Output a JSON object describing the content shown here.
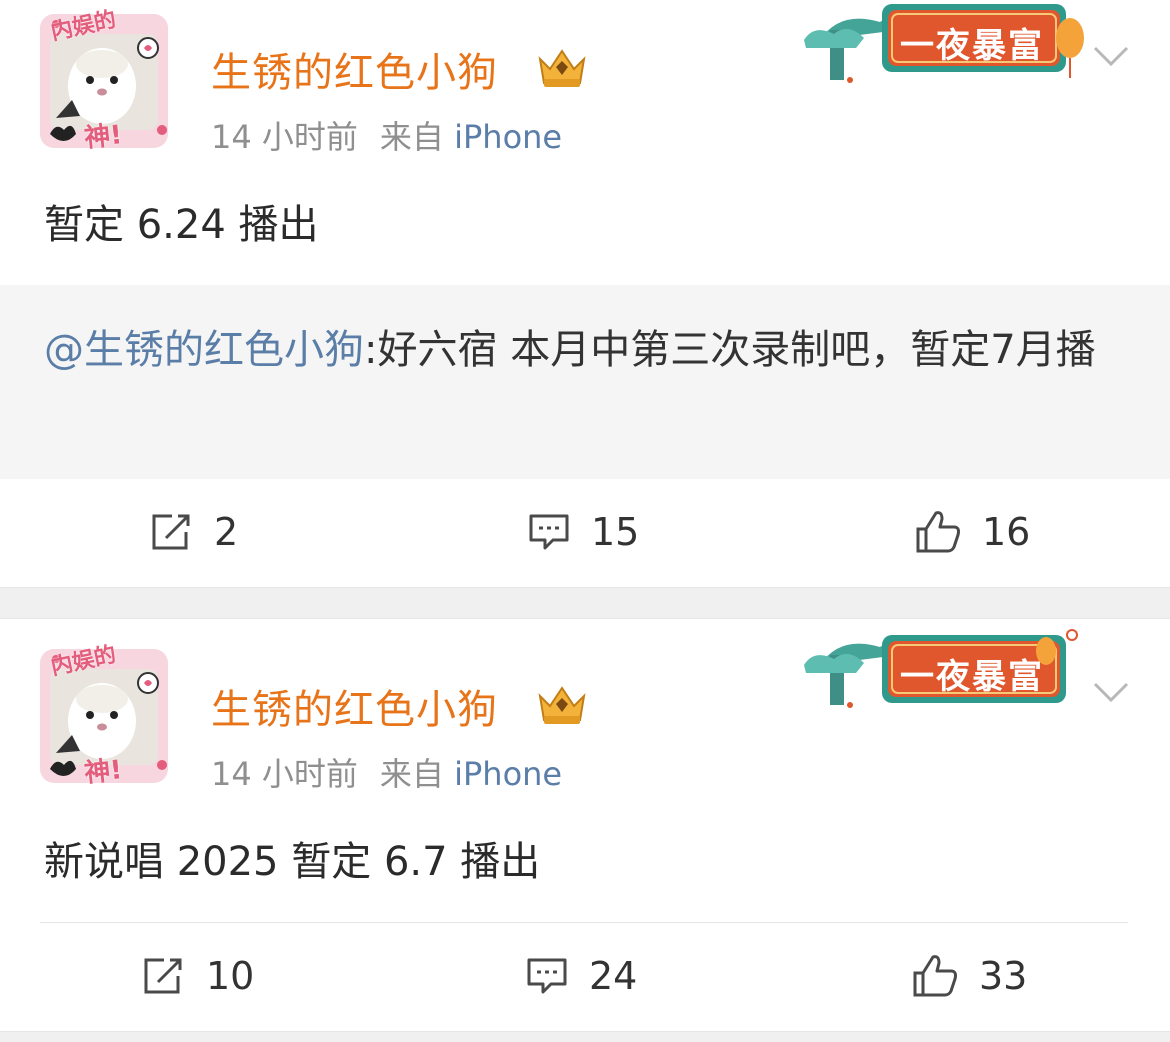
{
  "colors": {
    "username": "#e8741a",
    "source_link": "#5b7ea8",
    "mention": "#5b7ea8",
    "meta_gray": "#8f8f8f",
    "repost_bg": "#f5f5f5"
  },
  "icons": {
    "share": "share-icon",
    "comment": "comment-icon",
    "like": "like-icon",
    "menu": "chevron-down-icon",
    "vip": "crown-badge-icon"
  },
  "posts": [
    {
      "avatar": {
        "top_text": "内娱的",
        "bottom_text": "神!"
      },
      "username": "生锈的红色小狗",
      "time": "14 小时前",
      "source_prefix": "来自",
      "source": "iPhone",
      "banner_text": "一夜暴富",
      "text": "暂定 6.24 播出",
      "repost": {
        "mention": "@生锈的红色小狗",
        "text": ":好六宿 本月中第三次录制吧，暂定7月播"
      },
      "actions": {
        "share": "2",
        "comment": "15",
        "like": "16"
      }
    },
    {
      "avatar": {
        "top_text": "内娱的",
        "bottom_text": "神!"
      },
      "username": "生锈的红色小狗",
      "time": "14 小时前",
      "source_prefix": "来自",
      "source": "iPhone",
      "banner_text": "一夜暴富",
      "text": "新说唱 2025 暂定 6.7 播出",
      "actions": {
        "share": "10",
        "comment": "24",
        "like": "33"
      }
    }
  ]
}
